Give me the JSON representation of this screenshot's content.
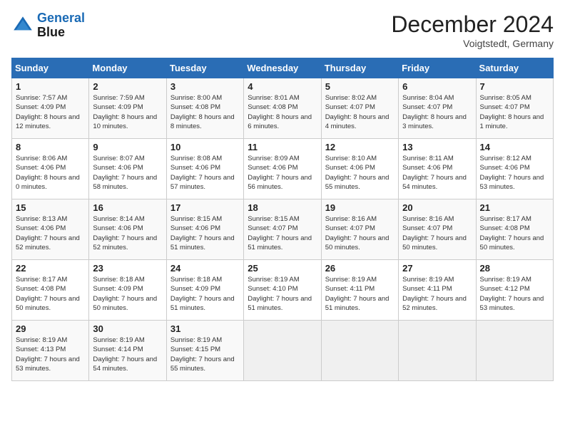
{
  "header": {
    "logo_line1": "General",
    "logo_line2": "Blue",
    "month_title": "December 2024",
    "location": "Voigtstedt, Germany"
  },
  "weekdays": [
    "Sunday",
    "Monday",
    "Tuesday",
    "Wednesday",
    "Thursday",
    "Friday",
    "Saturday"
  ],
  "weeks": [
    [
      {
        "day": "1",
        "info": "Sunrise: 7:57 AM\nSunset: 4:09 PM\nDaylight: 8 hours and 12 minutes."
      },
      {
        "day": "2",
        "info": "Sunrise: 7:59 AM\nSunset: 4:09 PM\nDaylight: 8 hours and 10 minutes."
      },
      {
        "day": "3",
        "info": "Sunrise: 8:00 AM\nSunset: 4:08 PM\nDaylight: 8 hours and 8 minutes."
      },
      {
        "day": "4",
        "info": "Sunrise: 8:01 AM\nSunset: 4:08 PM\nDaylight: 8 hours and 6 minutes."
      },
      {
        "day": "5",
        "info": "Sunrise: 8:02 AM\nSunset: 4:07 PM\nDaylight: 8 hours and 4 minutes."
      },
      {
        "day": "6",
        "info": "Sunrise: 8:04 AM\nSunset: 4:07 PM\nDaylight: 8 hours and 3 minutes."
      },
      {
        "day": "7",
        "info": "Sunrise: 8:05 AM\nSunset: 4:07 PM\nDaylight: 8 hours and 1 minute."
      }
    ],
    [
      {
        "day": "8",
        "info": "Sunrise: 8:06 AM\nSunset: 4:06 PM\nDaylight: 8 hours and 0 minutes."
      },
      {
        "day": "9",
        "info": "Sunrise: 8:07 AM\nSunset: 4:06 PM\nDaylight: 7 hours and 58 minutes."
      },
      {
        "day": "10",
        "info": "Sunrise: 8:08 AM\nSunset: 4:06 PM\nDaylight: 7 hours and 57 minutes."
      },
      {
        "day": "11",
        "info": "Sunrise: 8:09 AM\nSunset: 4:06 PM\nDaylight: 7 hours and 56 minutes."
      },
      {
        "day": "12",
        "info": "Sunrise: 8:10 AM\nSunset: 4:06 PM\nDaylight: 7 hours and 55 minutes."
      },
      {
        "day": "13",
        "info": "Sunrise: 8:11 AM\nSunset: 4:06 PM\nDaylight: 7 hours and 54 minutes."
      },
      {
        "day": "14",
        "info": "Sunrise: 8:12 AM\nSunset: 4:06 PM\nDaylight: 7 hours and 53 minutes."
      }
    ],
    [
      {
        "day": "15",
        "info": "Sunrise: 8:13 AM\nSunset: 4:06 PM\nDaylight: 7 hours and 52 minutes."
      },
      {
        "day": "16",
        "info": "Sunrise: 8:14 AM\nSunset: 4:06 PM\nDaylight: 7 hours and 52 minutes."
      },
      {
        "day": "17",
        "info": "Sunrise: 8:15 AM\nSunset: 4:06 PM\nDaylight: 7 hours and 51 minutes."
      },
      {
        "day": "18",
        "info": "Sunrise: 8:15 AM\nSunset: 4:07 PM\nDaylight: 7 hours and 51 minutes."
      },
      {
        "day": "19",
        "info": "Sunrise: 8:16 AM\nSunset: 4:07 PM\nDaylight: 7 hours and 50 minutes."
      },
      {
        "day": "20",
        "info": "Sunrise: 8:16 AM\nSunset: 4:07 PM\nDaylight: 7 hours and 50 minutes."
      },
      {
        "day": "21",
        "info": "Sunrise: 8:17 AM\nSunset: 4:08 PM\nDaylight: 7 hours and 50 minutes."
      }
    ],
    [
      {
        "day": "22",
        "info": "Sunrise: 8:17 AM\nSunset: 4:08 PM\nDaylight: 7 hours and 50 minutes."
      },
      {
        "day": "23",
        "info": "Sunrise: 8:18 AM\nSunset: 4:09 PM\nDaylight: 7 hours and 50 minutes."
      },
      {
        "day": "24",
        "info": "Sunrise: 8:18 AM\nSunset: 4:09 PM\nDaylight: 7 hours and 51 minutes."
      },
      {
        "day": "25",
        "info": "Sunrise: 8:19 AM\nSunset: 4:10 PM\nDaylight: 7 hours and 51 minutes."
      },
      {
        "day": "26",
        "info": "Sunrise: 8:19 AM\nSunset: 4:11 PM\nDaylight: 7 hours and 51 minutes."
      },
      {
        "day": "27",
        "info": "Sunrise: 8:19 AM\nSunset: 4:11 PM\nDaylight: 7 hours and 52 minutes."
      },
      {
        "day": "28",
        "info": "Sunrise: 8:19 AM\nSunset: 4:12 PM\nDaylight: 7 hours and 53 minutes."
      }
    ],
    [
      {
        "day": "29",
        "info": "Sunrise: 8:19 AM\nSunset: 4:13 PM\nDaylight: 7 hours and 53 minutes."
      },
      {
        "day": "30",
        "info": "Sunrise: 8:19 AM\nSunset: 4:14 PM\nDaylight: 7 hours and 54 minutes."
      },
      {
        "day": "31",
        "info": "Sunrise: 8:19 AM\nSunset: 4:15 PM\nDaylight: 7 hours and 55 minutes."
      },
      null,
      null,
      null,
      null
    ]
  ]
}
